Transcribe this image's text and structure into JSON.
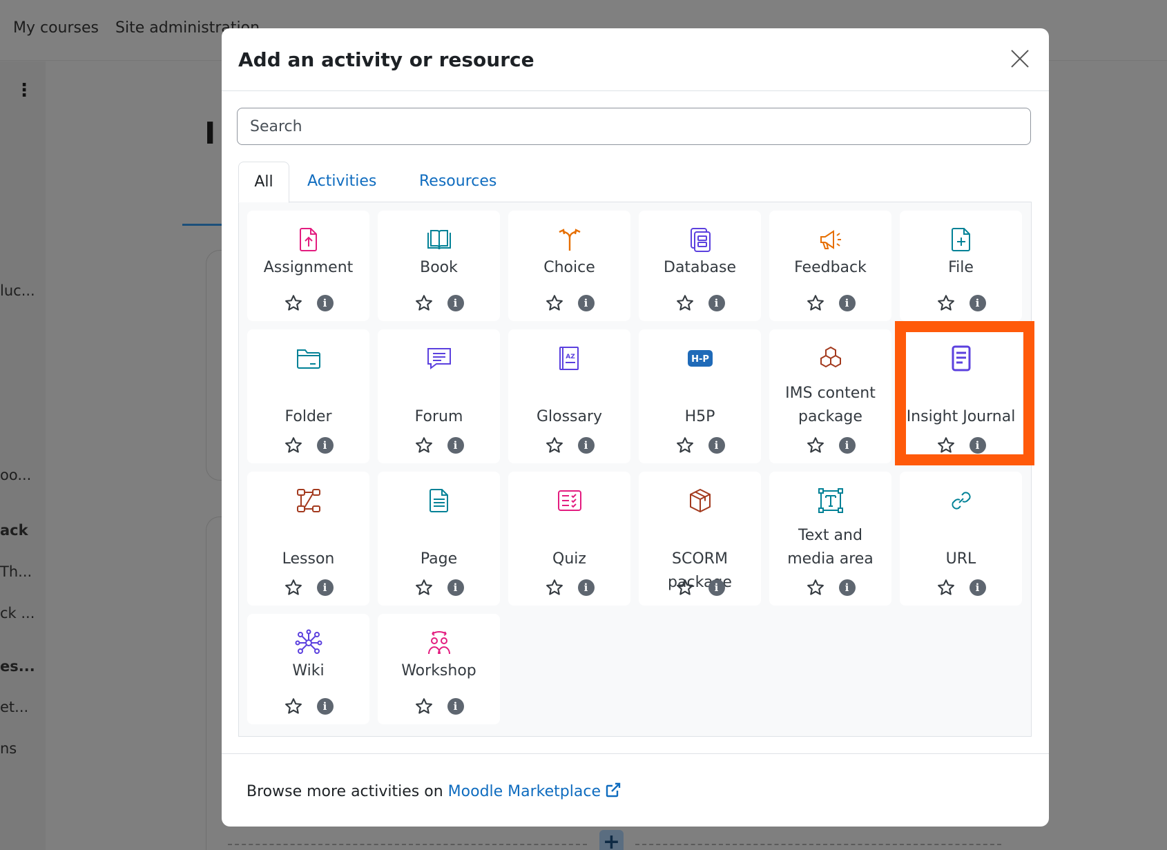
{
  "background": {
    "nav": [
      "My courses",
      "Site administration"
    ],
    "heading_fragment": "I",
    "sidebar_fragments": [
      "luc...",
      "oo...",
      "ack",
      "Th...",
      "ck ...",
      "es...",
      "et...",
      "ns"
    ]
  },
  "modal": {
    "title": "Add an activity or resource",
    "search_placeholder": "Search",
    "tabs": [
      "All",
      "Activities",
      "Resources"
    ],
    "active_tab": "All",
    "items": [
      {
        "name": "Assignment",
        "icon": "assignment-icon",
        "color": "#e31c7f"
      },
      {
        "name": "Book",
        "icon": "book-icon",
        "color": "#008196"
      },
      {
        "name": "Choice",
        "icon": "choice-icon",
        "color": "#e66e00"
      },
      {
        "name": "Database",
        "icon": "database-icon",
        "color": "#5b40de"
      },
      {
        "name": "Feedback",
        "icon": "feedback-icon",
        "color": "#e66e00"
      },
      {
        "name": "File",
        "icon": "file-icon",
        "color": "#008196"
      },
      {
        "name": "Folder",
        "icon": "folder-icon",
        "color": "#008196"
      },
      {
        "name": "Forum",
        "icon": "forum-icon",
        "color": "#5b40de"
      },
      {
        "name": "Glossary",
        "icon": "glossary-icon",
        "color": "#5b40de"
      },
      {
        "name": "H5P",
        "icon": "h5p-icon",
        "color": "#1f6ab8"
      },
      {
        "name": "IMS content package",
        "icon": "ims-package-icon",
        "color": "#a33a1e"
      },
      {
        "name": "Insight Journal",
        "icon": "journal-icon",
        "color": "#5b40de"
      },
      {
        "name": "Lesson",
        "icon": "lesson-icon",
        "color": "#a33a1e"
      },
      {
        "name": "Page",
        "icon": "page-icon",
        "color": "#008196"
      },
      {
        "name": "Quiz",
        "icon": "quiz-icon",
        "color": "#e31c7f"
      },
      {
        "name": "SCORM package",
        "icon": "scorm-icon",
        "color": "#a33a1e"
      },
      {
        "name": "Text and media area",
        "icon": "text-media-icon",
        "color": "#008196"
      },
      {
        "name": "URL",
        "icon": "url-icon",
        "color": "#008196"
      },
      {
        "name": "Wiki",
        "icon": "wiki-icon",
        "color": "#5b40de"
      },
      {
        "name": "Workshop",
        "icon": "workshop-icon",
        "color": "#e31c7f"
      }
    ],
    "highlighted_item": "Insight Journal",
    "highlight_color": "#ff5a0a",
    "footer": {
      "prefix": "Browse more activities on",
      "link": "Moodle Marketplace"
    }
  },
  "colors": {
    "link": "#0f6cbf",
    "overlay": "#7f7f7f"
  }
}
